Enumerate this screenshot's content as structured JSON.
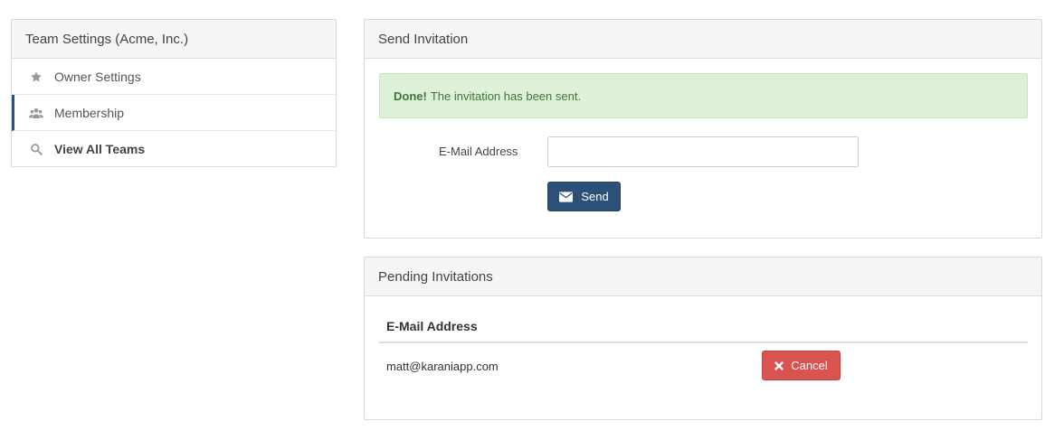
{
  "sidebar": {
    "title": "Team Settings (Acme, Inc.)",
    "items": [
      {
        "label": "Owner Settings",
        "icon": "star-icon"
      },
      {
        "label": "Membership",
        "icon": "users-icon"
      },
      {
        "label": "View All Teams",
        "icon": "search-icon"
      }
    ]
  },
  "invite": {
    "title": "Send Invitation",
    "alert_strong": "Done!",
    "alert_text": "The invitation has been sent.",
    "email_label": "E-Mail Address",
    "email_value": "",
    "send_label": "Send",
    "send_icon": "envelope-icon"
  },
  "pending": {
    "title": "Pending Invitations",
    "column_header": "E-Mail Address",
    "rows": [
      {
        "email": "matt@karaniapp.com",
        "action_label": "Cancel",
        "action_icon": "times-icon"
      }
    ]
  },
  "colors": {
    "primary": "#2c5077",
    "danger": "#d9534f",
    "success_bg": "#dff0d8",
    "success_text": "#3c763d"
  }
}
